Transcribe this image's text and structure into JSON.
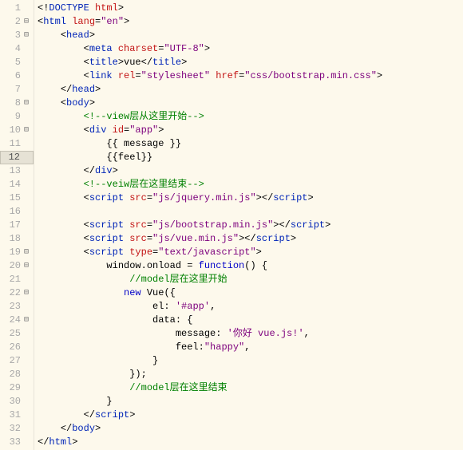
{
  "lines": [
    {
      "n": 1,
      "fold": "",
      "parts": [
        {
          "c": "t-bracket",
          "t": "<!"
        },
        {
          "c": "t-tag",
          "t": "DOCTYPE"
        },
        {
          "c": "t-text",
          "t": " "
        },
        {
          "c": "t-attr",
          "t": "html"
        },
        {
          "c": "t-bracket",
          "t": ">"
        }
      ]
    },
    {
      "n": 2,
      "fold": "⊟",
      "parts": [
        {
          "c": "t-bracket",
          "t": "<"
        },
        {
          "c": "t-tag",
          "t": "html"
        },
        {
          "c": "t-text",
          "t": " "
        },
        {
          "c": "t-attr",
          "t": "lang"
        },
        {
          "c": "t-bracket",
          "t": "="
        },
        {
          "c": "t-string",
          "t": "\"en\""
        },
        {
          "c": "t-bracket",
          "t": ">"
        }
      ]
    },
    {
      "n": 3,
      "fold": "⊟",
      "parts": [
        {
          "c": "t-text",
          "t": "    "
        },
        {
          "c": "t-bracket",
          "t": "<"
        },
        {
          "c": "t-tag",
          "t": "head"
        },
        {
          "c": "t-bracket",
          "t": ">"
        }
      ]
    },
    {
      "n": 4,
      "fold": "",
      "parts": [
        {
          "c": "t-text",
          "t": "        "
        },
        {
          "c": "t-bracket",
          "t": "<"
        },
        {
          "c": "t-tag",
          "t": "meta"
        },
        {
          "c": "t-text",
          "t": " "
        },
        {
          "c": "t-attr",
          "t": "charset"
        },
        {
          "c": "t-bracket",
          "t": "="
        },
        {
          "c": "t-string",
          "t": "\"UTF-8\""
        },
        {
          "c": "t-bracket",
          "t": ">"
        }
      ]
    },
    {
      "n": 5,
      "fold": "",
      "parts": [
        {
          "c": "t-text",
          "t": "        "
        },
        {
          "c": "t-bracket",
          "t": "<"
        },
        {
          "c": "t-tag",
          "t": "title"
        },
        {
          "c": "t-bracket",
          "t": ">"
        },
        {
          "c": "t-text",
          "t": "vue"
        },
        {
          "c": "t-bracket",
          "t": "</"
        },
        {
          "c": "t-tag",
          "t": "title"
        },
        {
          "c": "t-bracket",
          "t": ">"
        }
      ]
    },
    {
      "n": 6,
      "fold": "",
      "parts": [
        {
          "c": "t-text",
          "t": "        "
        },
        {
          "c": "t-bracket",
          "t": "<"
        },
        {
          "c": "t-tag",
          "t": "link"
        },
        {
          "c": "t-text",
          "t": " "
        },
        {
          "c": "t-attr",
          "t": "rel"
        },
        {
          "c": "t-bracket",
          "t": "="
        },
        {
          "c": "t-string",
          "t": "\"stylesheet\""
        },
        {
          "c": "t-text",
          "t": " "
        },
        {
          "c": "t-attr",
          "t": "href"
        },
        {
          "c": "t-bracket",
          "t": "="
        },
        {
          "c": "t-string",
          "t": "\"css/bootstrap.min.css\""
        },
        {
          "c": "t-bracket",
          "t": ">"
        }
      ]
    },
    {
      "n": 7,
      "fold": "",
      "parts": [
        {
          "c": "t-text",
          "t": "    "
        },
        {
          "c": "t-bracket",
          "t": "</"
        },
        {
          "c": "t-tag",
          "t": "head"
        },
        {
          "c": "t-bracket",
          "t": ">"
        }
      ]
    },
    {
      "n": 8,
      "fold": "⊟",
      "parts": [
        {
          "c": "t-text",
          "t": "    "
        },
        {
          "c": "t-bracket",
          "t": "<"
        },
        {
          "c": "t-tag",
          "t": "body"
        },
        {
          "c": "t-bracket",
          "t": ">"
        }
      ]
    },
    {
      "n": 9,
      "fold": "",
      "parts": [
        {
          "c": "t-text",
          "t": "        "
        },
        {
          "c": "t-comment",
          "t": "<!--view层从这里开始-->"
        }
      ]
    },
    {
      "n": 10,
      "fold": "⊟",
      "parts": [
        {
          "c": "t-text",
          "t": "        "
        },
        {
          "c": "t-bracket",
          "t": "<"
        },
        {
          "c": "t-tag",
          "t": "div"
        },
        {
          "c": "t-text",
          "t": " "
        },
        {
          "c": "t-attr",
          "t": "id"
        },
        {
          "c": "t-bracket",
          "t": "="
        },
        {
          "c": "t-string",
          "t": "\"app\""
        },
        {
          "c": "t-bracket",
          "t": ">"
        }
      ]
    },
    {
      "n": 11,
      "fold": "",
      "parts": [
        {
          "c": "t-text",
          "t": "            {{ message }}"
        }
      ]
    },
    {
      "n": 12,
      "fold": "",
      "current": true,
      "parts": [
        {
          "c": "t-text",
          "t": "            {{feel}}"
        }
      ]
    },
    {
      "n": 13,
      "fold": "",
      "parts": [
        {
          "c": "t-text",
          "t": "        "
        },
        {
          "c": "t-bracket",
          "t": "</"
        },
        {
          "c": "t-tag",
          "t": "div"
        },
        {
          "c": "t-bracket",
          "t": ">"
        }
      ]
    },
    {
      "n": 14,
      "fold": "",
      "parts": [
        {
          "c": "t-text",
          "t": "        "
        },
        {
          "c": "t-comment",
          "t": "<!--veiw层在这里结束-->"
        }
      ]
    },
    {
      "n": 15,
      "fold": "",
      "parts": [
        {
          "c": "t-text",
          "t": "        "
        },
        {
          "c": "t-bracket",
          "t": "<"
        },
        {
          "c": "t-tag",
          "t": "script"
        },
        {
          "c": "t-text",
          "t": " "
        },
        {
          "c": "t-attr",
          "t": "src"
        },
        {
          "c": "t-bracket",
          "t": "="
        },
        {
          "c": "t-string",
          "t": "\"js/jquery.min.js\""
        },
        {
          "c": "t-bracket",
          "t": "></"
        },
        {
          "c": "t-tag",
          "t": "script"
        },
        {
          "c": "t-bracket",
          "t": ">"
        }
      ]
    },
    {
      "n": 16,
      "fold": "",
      "parts": [
        {
          "c": "t-text",
          "t": ""
        }
      ]
    },
    {
      "n": 17,
      "fold": "",
      "parts": [
        {
          "c": "t-text",
          "t": "        "
        },
        {
          "c": "t-bracket",
          "t": "<"
        },
        {
          "c": "t-tag",
          "t": "script"
        },
        {
          "c": "t-text",
          "t": " "
        },
        {
          "c": "t-attr",
          "t": "src"
        },
        {
          "c": "t-bracket",
          "t": "="
        },
        {
          "c": "t-string",
          "t": "\"js/bootstrap.min.js\""
        },
        {
          "c": "t-bracket",
          "t": "></"
        },
        {
          "c": "t-tag",
          "t": "script"
        },
        {
          "c": "t-bracket",
          "t": ">"
        }
      ]
    },
    {
      "n": 18,
      "fold": "",
      "parts": [
        {
          "c": "t-text",
          "t": "        "
        },
        {
          "c": "t-bracket",
          "t": "<"
        },
        {
          "c": "t-tag",
          "t": "script"
        },
        {
          "c": "t-text",
          "t": " "
        },
        {
          "c": "t-attr",
          "t": "src"
        },
        {
          "c": "t-bracket",
          "t": "="
        },
        {
          "c": "t-string",
          "t": "\"js/vue.min.js\""
        },
        {
          "c": "t-bracket",
          "t": "></"
        },
        {
          "c": "t-tag",
          "t": "script"
        },
        {
          "c": "t-bracket",
          "t": ">"
        }
      ]
    },
    {
      "n": 19,
      "fold": "⊟",
      "parts": [
        {
          "c": "t-text",
          "t": "        "
        },
        {
          "c": "t-bracket",
          "t": "<"
        },
        {
          "c": "t-tag",
          "t": "script"
        },
        {
          "c": "t-text",
          "t": " "
        },
        {
          "c": "t-attr",
          "t": "type"
        },
        {
          "c": "t-bracket",
          "t": "="
        },
        {
          "c": "t-string",
          "t": "\"text/javascript\""
        },
        {
          "c": "t-bracket",
          "t": ">"
        }
      ]
    },
    {
      "n": 20,
      "fold": "⊟",
      "parts": [
        {
          "c": "t-text",
          "t": "            "
        },
        {
          "c": "t-js",
          "t": "window.onload = "
        },
        {
          "c": "t-keyword",
          "t": "function"
        },
        {
          "c": "t-js",
          "t": "() {"
        }
      ]
    },
    {
      "n": 21,
      "fold": "",
      "parts": [
        {
          "c": "t-text",
          "t": "                "
        },
        {
          "c": "t-comment",
          "t": "//model层在这里开始"
        }
      ]
    },
    {
      "n": 22,
      "fold": "⊟",
      "parts": [
        {
          "c": "t-text",
          "t": "               "
        },
        {
          "c": "t-keyword",
          "t": "new"
        },
        {
          "c": "t-js",
          "t": " Vue({"
        }
      ]
    },
    {
      "n": 23,
      "fold": "",
      "parts": [
        {
          "c": "t-text",
          "t": "                    "
        },
        {
          "c": "t-js",
          "t": "el: "
        },
        {
          "c": "t-jsstr",
          "t": "'#app'"
        },
        {
          "c": "t-js",
          "t": ","
        }
      ]
    },
    {
      "n": 24,
      "fold": "⊟",
      "parts": [
        {
          "c": "t-text",
          "t": "                    "
        },
        {
          "c": "t-js",
          "t": "data: {"
        }
      ]
    },
    {
      "n": 25,
      "fold": "",
      "parts": [
        {
          "c": "t-text",
          "t": "                        "
        },
        {
          "c": "t-js",
          "t": "message: "
        },
        {
          "c": "t-jsstr",
          "t": "'你好 vue.js!'"
        },
        {
          "c": "t-js",
          "t": ","
        }
      ]
    },
    {
      "n": 26,
      "fold": "",
      "parts": [
        {
          "c": "t-text",
          "t": "                        "
        },
        {
          "c": "t-js",
          "t": "feel:"
        },
        {
          "c": "t-jsstr",
          "t": "\"happy\""
        },
        {
          "c": "t-js",
          "t": ","
        }
      ]
    },
    {
      "n": 27,
      "fold": "",
      "parts": [
        {
          "c": "t-text",
          "t": "                    "
        },
        {
          "c": "t-js",
          "t": "}"
        }
      ]
    },
    {
      "n": 28,
      "fold": "",
      "parts": [
        {
          "c": "t-text",
          "t": "                "
        },
        {
          "c": "t-js",
          "t": "});"
        }
      ]
    },
    {
      "n": 29,
      "fold": "",
      "parts": [
        {
          "c": "t-text",
          "t": "                "
        },
        {
          "c": "t-comment",
          "t": "//model层在这里结束"
        }
      ]
    },
    {
      "n": 30,
      "fold": "",
      "parts": [
        {
          "c": "t-text",
          "t": "            "
        },
        {
          "c": "t-js",
          "t": "}"
        }
      ]
    },
    {
      "n": 31,
      "fold": "",
      "parts": [
        {
          "c": "t-text",
          "t": "        "
        },
        {
          "c": "t-bracket",
          "t": "</"
        },
        {
          "c": "t-tag",
          "t": "script"
        },
        {
          "c": "t-bracket",
          "t": ">"
        }
      ]
    },
    {
      "n": 32,
      "fold": "",
      "parts": [
        {
          "c": "t-text",
          "t": "    "
        },
        {
          "c": "t-bracket",
          "t": "</"
        },
        {
          "c": "t-tag",
          "t": "body"
        },
        {
          "c": "t-bracket",
          "t": ">"
        }
      ]
    },
    {
      "n": 33,
      "fold": "",
      "parts": [
        {
          "c": "t-bracket",
          "t": "</"
        },
        {
          "c": "t-tag",
          "t": "html"
        },
        {
          "c": "t-bracket",
          "t": ">"
        }
      ]
    }
  ]
}
